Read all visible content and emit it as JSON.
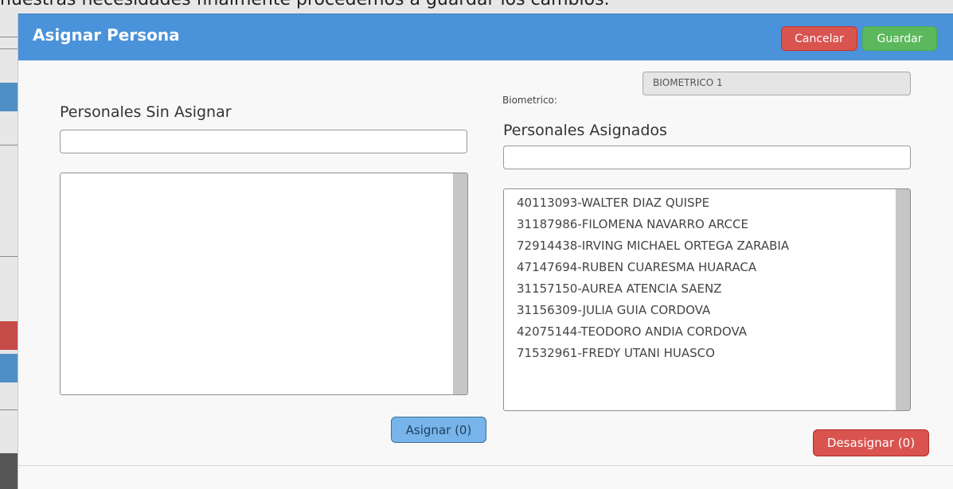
{
  "background": {
    "caption": "nuestras necesidades finalmente procedemos a guardar los cambios."
  },
  "modal": {
    "title": "Asignar Persona",
    "cancel_label": "Cancelar",
    "save_label": "Guardar",
    "biometric": {
      "label": "Biometrico:",
      "value": "BIOMETRICO 1"
    },
    "unassigned": {
      "title": "Personales Sin Asignar",
      "search_value": "",
      "items": [],
      "button_label": "Asignar (0)"
    },
    "assigned": {
      "title": "Personales Asignados",
      "search_value": "",
      "items": [
        "40113093-WALTER DIAZ QUISPE",
        "31187986-FILOMENA NAVARRO ARCCE",
        "72914438-IRVING MICHAEL ORTEGA ZARABIA",
        "47147694-RUBEN CUARESMA HUARACA",
        "31157150-AUREA ATENCIA SAENZ",
        "31156309-JULIA GUIA CORDOVA",
        "42075144-TEODORO ANDIA CORDOVA",
        "71532961-FREDY UTANI HUASCO"
      ],
      "button_label": "Desasignar (0)"
    }
  },
  "colors": {
    "header": "#4a92d9",
    "cancel": "#d9534f",
    "save": "#5cb85c",
    "assign": "#77b4ea"
  }
}
